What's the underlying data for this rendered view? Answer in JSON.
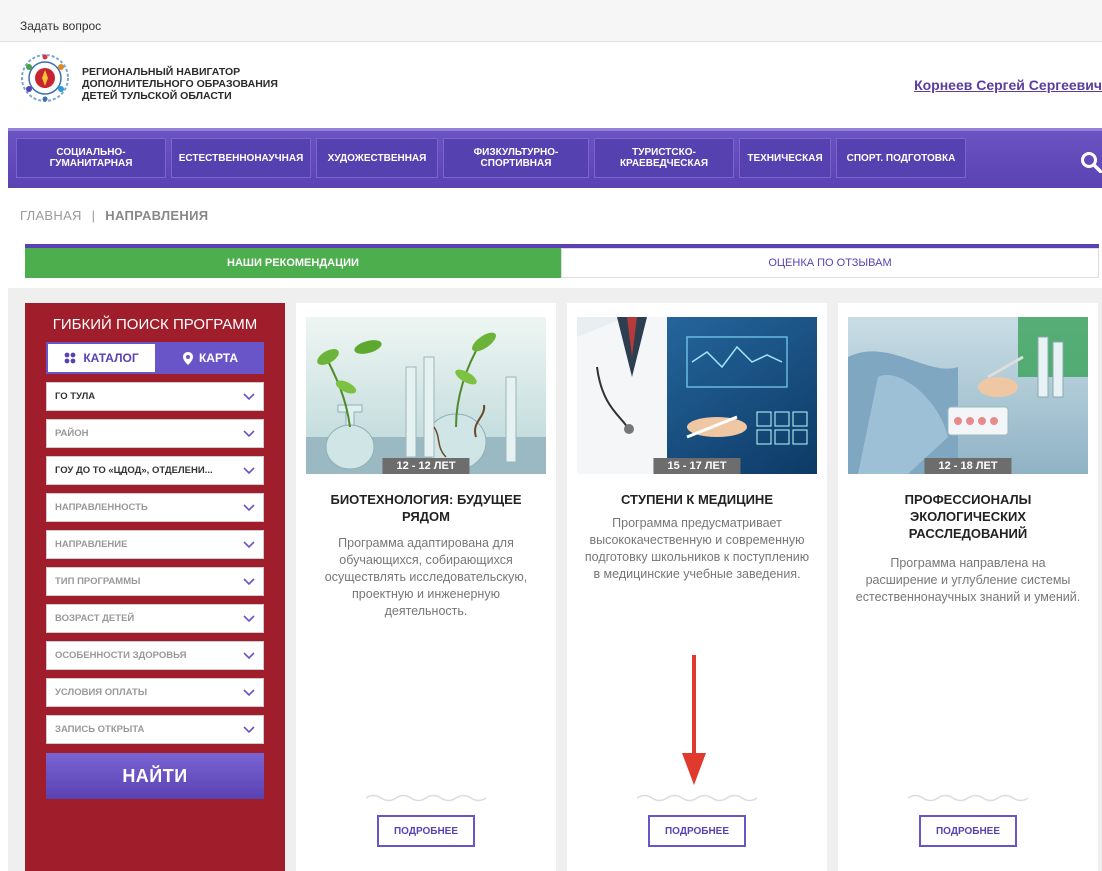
{
  "topbar": {
    "ask_label": "Задать вопрос"
  },
  "header": {
    "logo_lines": [
      "Региональный навигатор",
      "дополнительного образования",
      "детей Тульской области"
    ],
    "user_name": "Корнеев Сергей Сергеевич"
  },
  "nav": {
    "items": [
      {
        "line1": "СОЦИАЛЬНО-",
        "line2": "ГУМАНИТАРНАЯ"
      },
      {
        "line1": "ЕСТЕСТВЕННОНАУЧНАЯ",
        "line2": ""
      },
      {
        "line1": "ХУДОЖЕСТВЕННАЯ",
        "line2": ""
      },
      {
        "line1": "ФИЗКУЛЬТУРНО-",
        "line2": "СПОРТИВНАЯ"
      },
      {
        "line1": "ТУРИСТСКО-",
        "line2": "КРАЕВЕДЧЕСКАЯ"
      },
      {
        "line1": "ТЕХНИЧЕСКАЯ",
        "line2": ""
      },
      {
        "line1": "СПОРТ. ПОДГОТОВКА",
        "line2": ""
      }
    ]
  },
  "breadcrumb": {
    "home": "ГЛАВНАЯ",
    "separator": "|",
    "current": "НАПРАВЛЕНИЯ"
  },
  "tabs": {
    "recommendations": "НАШИ РЕКОМЕНДАЦИИ",
    "reviews": "ОЦЕНКА ПО ОТЗЫВАМ"
  },
  "filter": {
    "title": "ГИБКИЙ ПОИСК ПРОГРАММ",
    "catalog_label": "КАТАЛОГ",
    "map_label": "КАРТА",
    "selects": [
      {
        "label": "ГО ТУЛА",
        "filled": true
      },
      {
        "label": "РАЙОН",
        "filled": false
      },
      {
        "label": "ГОУ ДО ТО «ЦДОД», ОТДЕЛЕНИ...",
        "filled": true
      },
      {
        "label": "НАПРАВЛЕННОСТЬ",
        "filled": false
      },
      {
        "label": "НАПРАВЛЕНИЕ",
        "filled": false
      },
      {
        "label": "ТИП ПРОГРАММЫ",
        "filled": false
      },
      {
        "label": "ВОЗРАСТ ДЕТЕЙ",
        "filled": false
      },
      {
        "label": "ОСОБЕННОСТИ ЗДОРОВЬЯ",
        "filled": false
      },
      {
        "label": "УСЛОВИЯ ОПЛАТЫ",
        "filled": false
      },
      {
        "label": "ЗАПИСЬ ОТКРЫТА",
        "filled": false
      }
    ],
    "find_label": "НАЙТИ"
  },
  "cards": [
    {
      "age": "12 - 12 ЛЕТ",
      "title": "БИОТЕХНОЛОГИЯ: БУДУЩЕЕ РЯДОМ",
      "description": "Программа адаптирована для обучающихся, собирающихся осуществлять исследовательскую, проектную и инженерную деятельность.",
      "more_label": "ПОДРОБНЕЕ"
    },
    {
      "age": "15 - 17 ЛЕТ",
      "title": "СТУПЕНИ К МЕДИЦИНЕ",
      "description": "Программа предусматривает высококачественную и современную подготовку школьников к поступлению в медицинские учебные заведения.",
      "more_label": "ПОДРОБНЕЕ"
    },
    {
      "age": "12 - 18 ЛЕТ",
      "title": "ПРОФЕССИОНАЛЫ ЭКОЛОГИЧЕСКИХ РАССЛЕДОВАНИЙ",
      "description": "Программа направлена на расширение и углубление системы естественнонаучных знаний и умений.",
      "more_label": "ПОДРОБНЕЕ"
    }
  ],
  "colors": {
    "accent": "#5a42b3",
    "filter_bg": "#a01d2c",
    "active_tab": "#4cae4c",
    "annotation_arrow": "#e03a2e"
  }
}
